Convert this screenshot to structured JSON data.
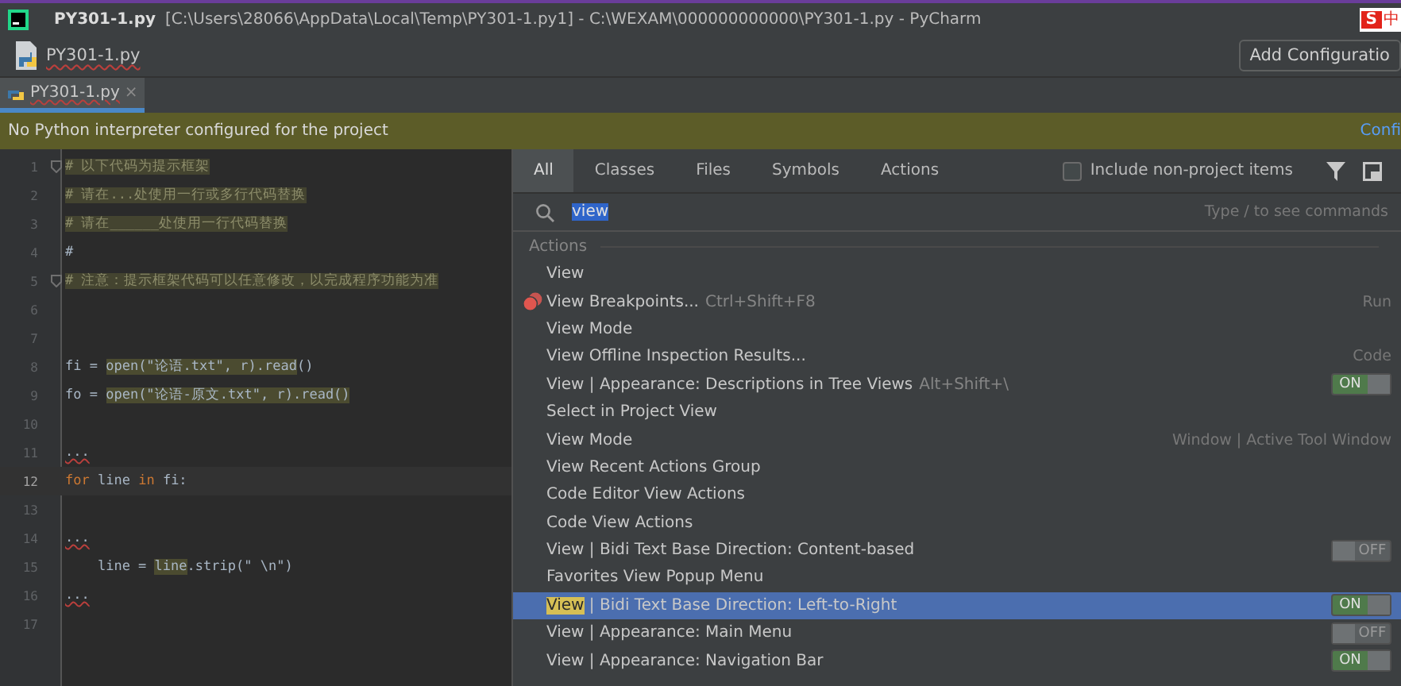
{
  "window": {
    "title_file": "PY301-1.py",
    "title_path": "[C:\\Users\\28066\\AppData\\Local\\Temp\\PY301-1.py1] - C:\\WEXAM\\000000000000\\PY301-1.py - PyCharm",
    "ime_letter": "S",
    "ime_text": "中"
  },
  "nav_bar": {
    "file": "PY301-1.py",
    "config_button": "Add Configuratio"
  },
  "editor_tabs": [
    {
      "label": "PY301-1.py",
      "close": "×",
      "selected": true
    }
  ],
  "banner": {
    "message": "No Python interpreter configured for the project",
    "link": "Confi"
  },
  "editor": {
    "lines": [
      {
        "number": "1",
        "current": false,
        "fold": true,
        "tokens": [
          {
            "text": "# 以下代码为提示框架",
            "kind": "comment"
          }
        ]
      },
      {
        "number": "2",
        "current": false,
        "fold": false,
        "tokens": [
          {
            "text": "# 请在...处使用一行或多行代码替换",
            "kind": "comment"
          }
        ]
      },
      {
        "number": "3",
        "current": false,
        "fold": false,
        "tokens": [
          {
            "text": "# 请在______处使用一行代码替换",
            "kind": "comment"
          }
        ]
      },
      {
        "number": "4",
        "current": false,
        "fold": false,
        "tokens": [
          {
            "text": "#",
            "kind": "plain"
          }
        ]
      },
      {
        "number": "5",
        "current": false,
        "fold": true,
        "tokens": [
          {
            "text": "# 注意：提示框架代码可以任意修改，以完成程序功能为准",
            "kind": "comment"
          }
        ]
      },
      {
        "number": "6",
        "current": false,
        "fold": false
      },
      {
        "number": "7",
        "current": false,
        "fold": false
      },
      {
        "number": "8",
        "current": false,
        "fold": false,
        "tokens": [
          {
            "text": "fi = ",
            "kind": "plain"
          },
          {
            "text": "open(\"论语.txt\", r).read",
            "kind": "hl"
          },
          {
            "text": "()",
            "kind": "plain"
          }
        ]
      },
      {
        "number": "9",
        "current": false,
        "fold": false,
        "tokens": [
          {
            "text": "fo = ",
            "kind": "plain"
          },
          {
            "text": "open(\"论语-原文.txt\", r).read()",
            "kind": "hl"
          }
        ]
      },
      {
        "number": "10",
        "current": false,
        "fold": false
      },
      {
        "number": "11",
        "current": false,
        "fold": false,
        "tokens": [
          {
            "text": "...",
            "kind": "error"
          }
        ]
      },
      {
        "number": "12",
        "current": true,
        "fold": false,
        "tokens": [
          {
            "text": "for",
            "kind": "keyword"
          },
          {
            "text": " line ",
            "kind": "plain"
          },
          {
            "text": "in",
            "kind": "keyword"
          },
          {
            "text": " fi:",
            "kind": "plain"
          }
        ]
      },
      {
        "number": "13",
        "current": false,
        "fold": false
      },
      {
        "number": "14",
        "current": false,
        "fold": false,
        "tokens": [
          {
            "text": "...",
            "kind": "error"
          }
        ]
      },
      {
        "number": "15",
        "current": false,
        "fold": false,
        "tokens": [
          {
            "text": "    line = ",
            "kind": "plain"
          },
          {
            "text": "line",
            "kind": "hl"
          },
          {
            "text": ".strip(\" \\n\")",
            "kind": "plain"
          }
        ]
      },
      {
        "number": "16",
        "current": false,
        "fold": false,
        "tokens": [
          {
            "text": "...",
            "kind": "error"
          }
        ]
      },
      {
        "number": "17",
        "current": false,
        "fold": false
      }
    ]
  },
  "popup": {
    "tabs": [
      {
        "label": "All",
        "selected": true
      },
      {
        "label": "Classes",
        "selected": false
      },
      {
        "label": "Files",
        "selected": false
      },
      {
        "label": "Symbols",
        "selected": false
      },
      {
        "label": "Actions",
        "selected": false
      }
    ],
    "include_non_project": {
      "label": "Include non-project items",
      "checked": false
    },
    "search": {
      "value": "view",
      "hint": "Type / to see commands"
    },
    "section": "Actions",
    "rows": [
      {
        "kind": "action",
        "match": "View",
        "selected": false
      },
      {
        "kind": "breakpoint",
        "match": "View",
        "label": " Breakpoints...",
        "shortcut": "Ctrl+Shift+F8",
        "category": "Run",
        "selected": false
      },
      {
        "kind": "action",
        "match": "View",
        "label": " Mode",
        "selected": false
      },
      {
        "kind": "action",
        "match": "View",
        "label": " Offline Inspection Results...",
        "category": "Code",
        "selected": false
      },
      {
        "kind": "toggle",
        "match": "View",
        "label": " | Appearance: Descriptions in Tree Views",
        "shortcut": "Alt+Shift+\\",
        "toggle": "ON",
        "on": true,
        "selected": false
      },
      {
        "kind": "action",
        "label": "Select in Project View",
        "selected": false
      },
      {
        "kind": "action",
        "match": "View",
        "label": " Mode",
        "category": "Window | Active Tool Window",
        "selected": false
      },
      {
        "kind": "action",
        "match": "View",
        "label": " Recent Actions Group",
        "selected": false
      },
      {
        "kind": "action",
        "label": "Code Editor View Actions",
        "selected": false
      },
      {
        "kind": "action",
        "label": "Code View Actions",
        "selected": false
      },
      {
        "kind": "toggle",
        "match": "View",
        "label": " | Bidi Text Base Direction: Content-based",
        "toggle": "OFF",
        "on": false,
        "selected": false
      },
      {
        "kind": "action",
        "label": "Favorites View Popup Menu",
        "selected": false
      },
      {
        "kind": "toggle",
        "match": "View",
        "label": " | Bidi Text Base Direction: Left-to-Right",
        "toggle": "ON",
        "on": true,
        "selected": true
      },
      {
        "kind": "toggle",
        "match": "View",
        "label": " | Appearance: Main Menu",
        "toggle": "OFF",
        "on": false,
        "selected": false
      },
      {
        "kind": "toggle",
        "match": "View",
        "label": " | Appearance: Navigation Bar",
        "toggle": "ON",
        "on": true,
        "selected": false
      }
    ]
  }
}
